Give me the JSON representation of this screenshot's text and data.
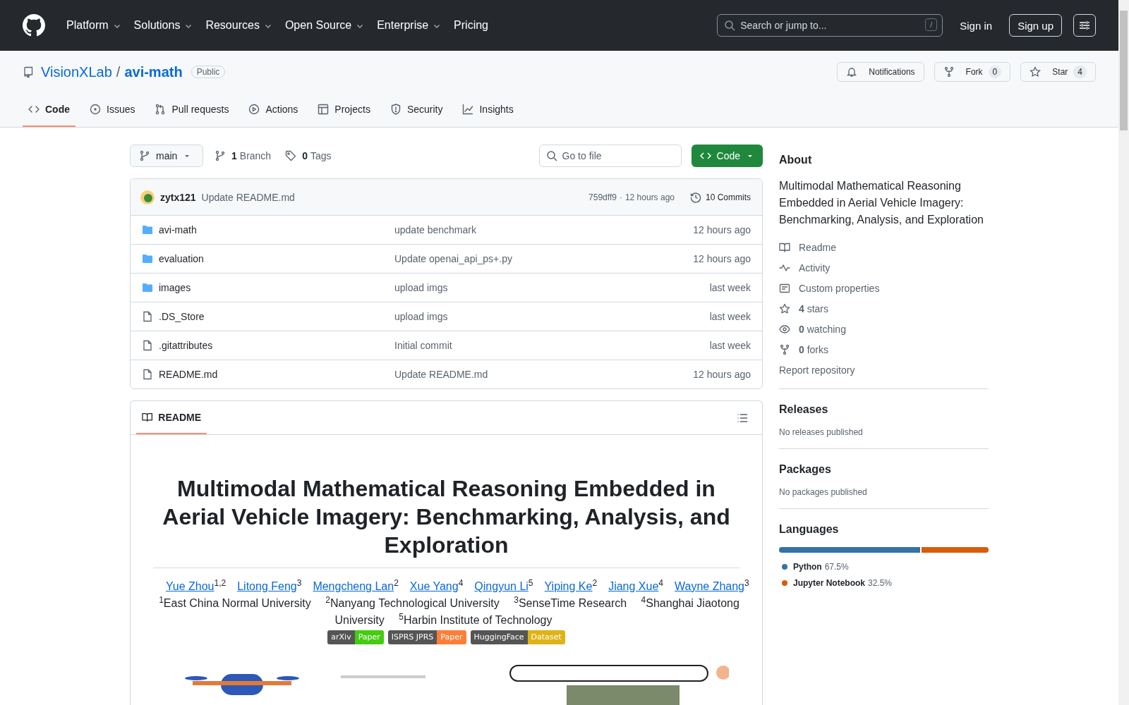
{
  "header": {
    "nav": [
      {
        "label": "Platform",
        "has_menu": true
      },
      {
        "label": "Solutions",
        "has_menu": true
      },
      {
        "label": "Resources",
        "has_menu": true
      },
      {
        "label": "Open Source",
        "has_menu": true
      },
      {
        "label": "Enterprise",
        "has_menu": true
      },
      {
        "label": "Pricing",
        "has_menu": false
      }
    ],
    "search": {
      "placeholder": "Search or jump to...",
      "shortcut": "/"
    },
    "sign_in": "Sign in",
    "sign_up": "Sign up"
  },
  "repo": {
    "owner": "VisionXLab",
    "separator": "/",
    "name": "avi-math",
    "visibility": "Public",
    "actions": [
      {
        "label": "Notifications"
      },
      {
        "label": "Fork",
        "count": "0"
      },
      {
        "label": "Star",
        "count": "4"
      }
    ]
  },
  "tabs": [
    {
      "label": "Code",
      "selected": true
    },
    {
      "label": "Issues",
      "selected": false
    },
    {
      "label": "Pull requests",
      "selected": false
    },
    {
      "label": "Actions",
      "selected": false
    },
    {
      "label": "Projects",
      "selected": false
    },
    {
      "label": "Security",
      "selected": false
    },
    {
      "label": "Insights",
      "selected": false
    }
  ],
  "toolbar": {
    "branch": "main",
    "branches": {
      "count": "1",
      "label": "Branch"
    },
    "tags": {
      "count": "0",
      "label": "Tags"
    },
    "go_to_file": {
      "placeholder": "Go to file"
    },
    "code_button": "Code"
  },
  "latest_commit": {
    "author": "zytx121",
    "message": "Update README.md",
    "hash": "759dff9",
    "separator": "·",
    "time": "12 hours ago",
    "commits": "10 Commits"
  },
  "files": [
    {
      "kind": "folder",
      "name": "avi-math",
      "message": "update benchmark",
      "time": "12 hours ago"
    },
    {
      "kind": "folder",
      "name": "evaluation",
      "message": "Update openai_api_ps+.py",
      "time": "12 hours ago"
    },
    {
      "kind": "folder",
      "name": "images",
      "message": "upload imgs",
      "time": "last week"
    },
    {
      "kind": "file",
      "name": ".DS_Store",
      "message": "upload imgs",
      "time": "last week"
    },
    {
      "kind": "file",
      "name": ".gitattributes",
      "message": "Initial commit",
      "time": "last week"
    },
    {
      "kind": "file",
      "name": "README.md",
      "message": "Update README.md",
      "time": "12 hours ago"
    }
  ],
  "readme": {
    "tab": "README",
    "title": "Multimodal Mathematical Reasoning Embedded in Aerial Vehicle Imagery: Benchmarking, Analysis, and Exploration",
    "authors": [
      {
        "name": "Yue Zhou",
        "sup": "1,2"
      },
      {
        "name": "Litong Feng",
        "sup": "3"
      },
      {
        "name": "Mengcheng Lan",
        "sup": "2"
      },
      {
        "name": "Xue Yang",
        "sup": "4"
      },
      {
        "name": "Qingyun Li",
        "sup": "5"
      },
      {
        "name": "Yiping Ke",
        "sup": "2"
      },
      {
        "name": "Jiang Xue",
        "sup": "4"
      },
      {
        "name": "Wayne Zhang",
        "sup": "3"
      }
    ],
    "affiliations": [
      {
        "sup": "1",
        "name": "East China Normal University"
      },
      {
        "sup": "2",
        "name": "Nanyang Technological University"
      },
      {
        "sup": "3",
        "name": "SenseTime Research"
      },
      {
        "sup": "4",
        "name": "Shanghai Jiaotong University"
      },
      {
        "sup": "5",
        "name": "Harbin Institute of Technology"
      }
    ],
    "badges": [
      {
        "left": "arXiv",
        "right": "Paper",
        "color": "#4c1"
      },
      {
        "left": "ISPRS JPRS",
        "right": "Paper",
        "color": "#fe7d37"
      },
      {
        "left": "HuggingFace",
        "right": "Dataset",
        "color": "#dfb317"
      }
    ]
  },
  "about": {
    "heading": "About",
    "description": "Multimodal Mathematical Reasoning Embedded in Aerial Vehicle Imagery: Benchmarking, Analysis, and Exploration",
    "links": [
      {
        "label": "Readme"
      },
      {
        "label": "Activity"
      },
      {
        "label": "Custom properties"
      },
      {
        "count": "4",
        "label": "stars"
      },
      {
        "count": "0",
        "label": "watching"
      },
      {
        "count": "0",
        "label": "forks"
      }
    ],
    "report": "Report repository"
  },
  "releases": {
    "heading": "Releases",
    "text": "No releases published"
  },
  "packages": {
    "heading": "Packages",
    "text": "No packages published"
  },
  "languages": {
    "heading": "Languages",
    "items": [
      {
        "name": "Python",
        "percent": "67.5%",
        "color": "#3572a5",
        "level": 0.675
      },
      {
        "name": "Jupyter Notebook",
        "percent": "32.5%",
        "color": "#da5b0b",
        "level": 0.325
      }
    ]
  }
}
